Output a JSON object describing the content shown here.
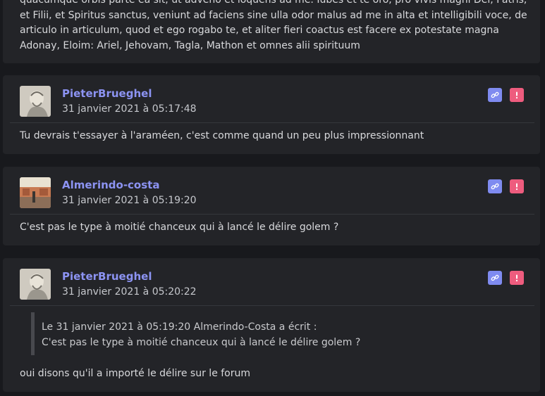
{
  "top_post": {
    "text": "quacumque orbis parte ea sit, ut adveno et loquens ad me. Iubes et te oro, pro vivis magni Dei, Patris, et Filii, et Spiritus sanctus, veniunt ad faciens sine ulla odor malus ad me in alta et intelligibili voce, de articulo in articulum, quod et ego rogabo te, et aliter fieri coactus est facere ex potestate magna Adonay, Eloim: Ariel, Jehovam, Tagla, Mathon et omnes alii spirituum"
  },
  "posts": [
    {
      "username": "PieterBrueghel",
      "date": "31 janvier 2021 à 05:17:48",
      "content": "Tu devrais t'essayer à l'araméen, c'est comme quand un peu plus impressionnant"
    },
    {
      "username": "Almerindo-costa",
      "date": "31 janvier 2021 à 05:19:20",
      "content": "C'est pas le type à moitié chanceux qui à lancé le délire golem ?"
    },
    {
      "username": "PieterBrueghel",
      "date": "31 janvier 2021 à 05:20:22",
      "quote_header": "Le 31 janvier 2021 à 05:19:20 Almerindo-Costa a écrit :",
      "quote_text": "C'est pas le type à moitié chanceux qui à lancé le délire golem ?",
      "content": "oui disons qu'il a importé le délire sur le forum"
    }
  ],
  "icons": {
    "link": "link-icon",
    "report": "exclamation-icon"
  },
  "colors": {
    "username": "#8c93f2",
    "link_button": "#7f8bf0",
    "report_button": "#ee5c7e",
    "card_bg": "#232428",
    "page_bg": "#18191d"
  }
}
